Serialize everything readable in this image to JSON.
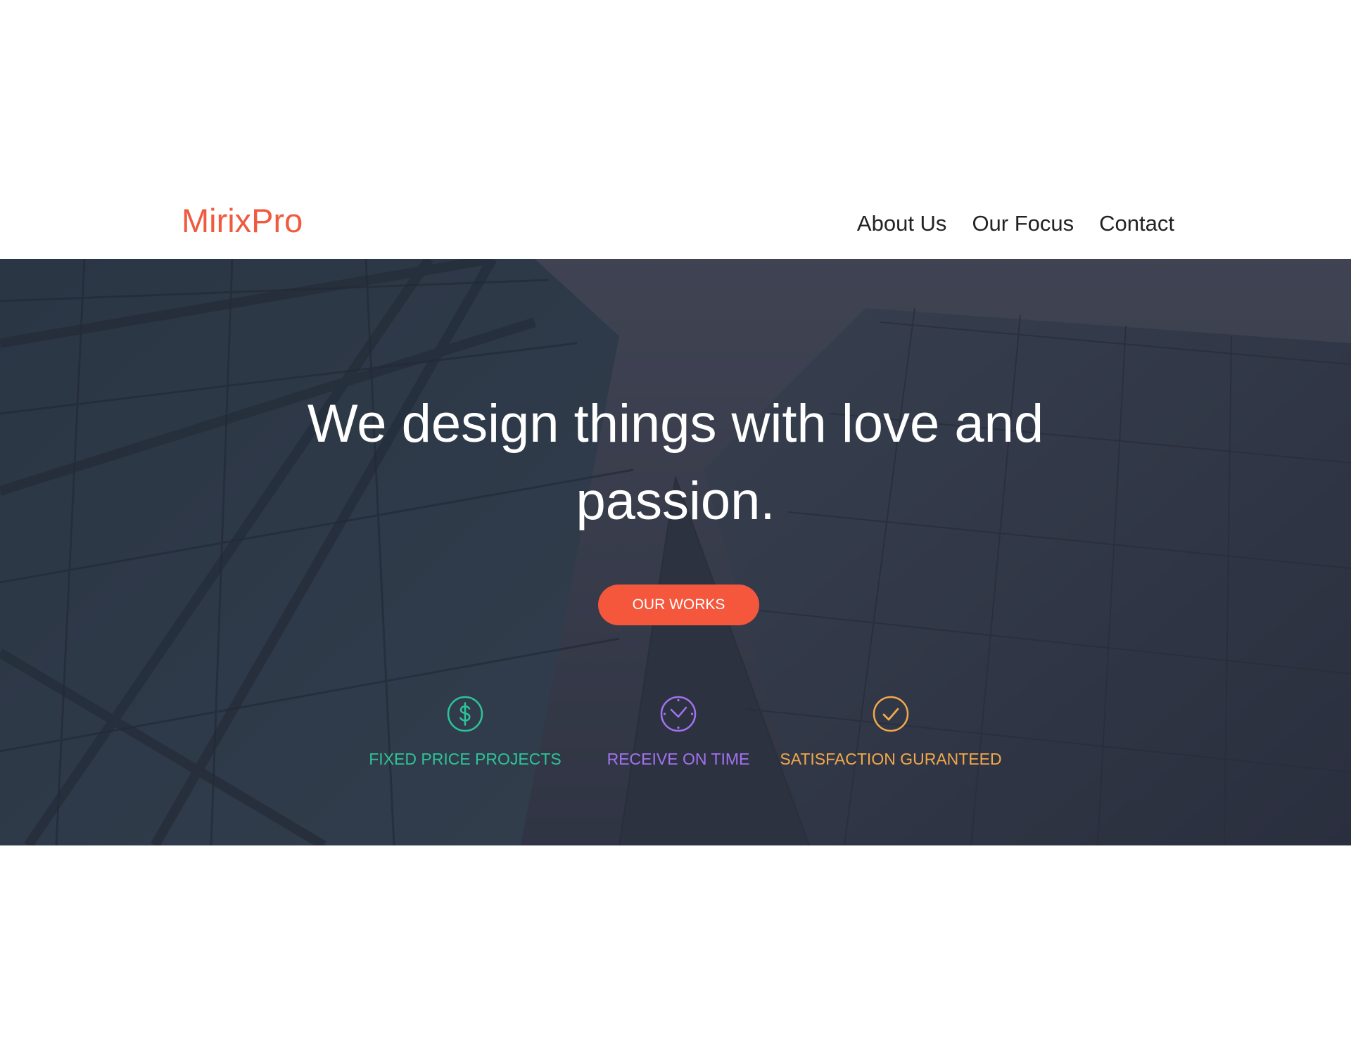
{
  "brand": {
    "logo_text": "MirixPro",
    "color": "#f05a3f"
  },
  "nav": {
    "items": [
      {
        "label": "About Us"
      },
      {
        "label": "Our Focus"
      },
      {
        "label": "Contact"
      }
    ]
  },
  "hero": {
    "title": "We design things with love and passion.",
    "cta_label": "OUR WORKS",
    "cta_color": "#f4573c",
    "features": [
      {
        "label": "FIXED PRICE PROJECTS",
        "icon": "dollar-circle-icon",
        "color": "#2ec498"
      },
      {
        "label": "RECEIVE ON TIME",
        "icon": "clock-icon",
        "color": "#a372f0"
      },
      {
        "label": "SATISFACTION GURANTEED",
        "icon": "check-circle-icon",
        "color": "#f3a84a"
      }
    ]
  }
}
